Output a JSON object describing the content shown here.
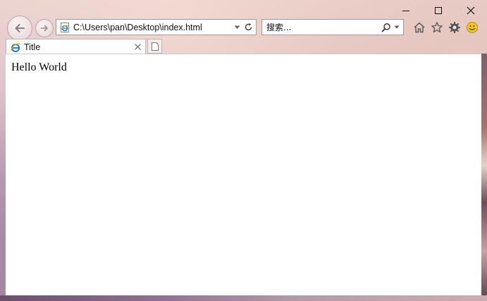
{
  "window": {
    "controls": {
      "minimize_icon": "minimize-icon",
      "maximize_icon": "maximize-icon",
      "close_icon": "close-icon"
    }
  },
  "navigation": {
    "back_icon": "back-arrow-icon",
    "forward_icon": "forward-arrow-icon"
  },
  "address_bar": {
    "url": "C:\\Users\\pan\\Desktop\\index.html",
    "dropdown_icon": "chevron-down-icon",
    "refresh_icon": "refresh-icon"
  },
  "search": {
    "placeholder": "搜索...",
    "search_icon": "search-icon"
  },
  "toolbar": {
    "icons": [
      "home-icon",
      "favorites-star-icon",
      "gear-icon",
      "smiley-feedback-icon"
    ]
  },
  "tabs": [
    {
      "title": "Title",
      "active": true
    }
  ],
  "page": {
    "body_text": "Hello World"
  },
  "colors": {
    "ie_blue": "#1f78c8",
    "ie_gold": "#e8a21e"
  }
}
